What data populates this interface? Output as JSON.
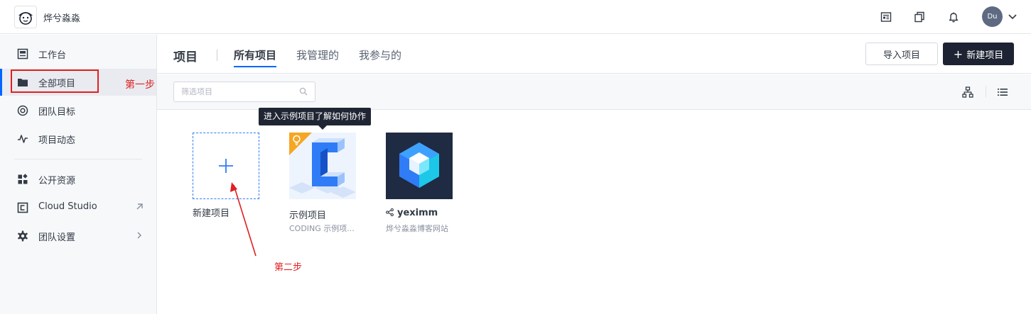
{
  "app": {
    "team_name": "烨兮淼淼",
    "avatar_initials": "Du",
    "accent_color": "#0066ff"
  },
  "topbar_icons": [
    "news-icon",
    "copy-window-icon",
    "bell-icon"
  ],
  "sidebar": {
    "items": [
      {
        "label": "工作台",
        "icon": "workbench-icon"
      },
      {
        "label": "全部项目",
        "icon": "folder-icon",
        "active": true
      },
      {
        "label": "团队目标",
        "icon": "target-icon"
      },
      {
        "label": "项目动态",
        "icon": "activity-pulse-icon"
      },
      {
        "label": "公开资源",
        "icon": "resources-grid-icon"
      },
      {
        "label": "Cloud Studio",
        "icon": "cloud-studio-icon",
        "external": true
      },
      {
        "label": "团队设置",
        "icon": "gear-icon",
        "submenu": true
      }
    ]
  },
  "header": {
    "title": "项目",
    "tabs": [
      {
        "label": "所有项目",
        "active": true
      },
      {
        "label": "我管理的"
      },
      {
        "label": "我参与的"
      }
    ],
    "import_label": "导入项目",
    "new_label": "新建项目"
  },
  "filter": {
    "placeholder": "筛选项目"
  },
  "tooltip": "进入示例项目了解如何协作",
  "new_project": {
    "label": "新建项目"
  },
  "projects": [
    {
      "name": "示例项目",
      "desc": "CODING 示例项...",
      "badge": "lightbulb-icon"
    },
    {
      "name": "yeximm",
      "desc": "烨兮淼淼博客网站",
      "shared": true
    }
  ],
  "annotations": {
    "step1": "第一步",
    "step2": "第二步",
    "color": "#e02020"
  }
}
